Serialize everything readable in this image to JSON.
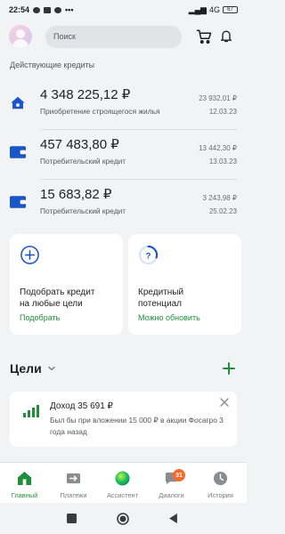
{
  "status_bar": {
    "time": "22:54",
    "signal": "4G",
    "battery": "67"
  },
  "header": {
    "search_placeholder": "Поиск",
    "avatar_icon": "user-avatar",
    "cart_icon": "shopping-cart-icon",
    "bell_icon": "bell-icon"
  },
  "credits": {
    "section_label": "Действующие кредиты",
    "items": [
      {
        "icon": "house-icon",
        "amount": "4 348 225,12 ₽",
        "description": "Приобретение строящегося жилья",
        "payment": "23 932,01 ₽",
        "date": "12.03.23"
      },
      {
        "icon": "wallet-icon",
        "amount": "457 483,80 ₽",
        "description": "Потребительский кредит",
        "payment": "13 442,30 ₽",
        "date": "13.03.23"
      },
      {
        "icon": "wallet-icon",
        "amount": "15 683,82 ₽",
        "description": "Потребительский кредит",
        "payment": "3 243,98 ₽",
        "date": "25.02.23"
      }
    ]
  },
  "cards": {
    "pick": {
      "title_line1": "Подобрать кредит",
      "title_line2": "на любые цели",
      "action": "Подобрать"
    },
    "potential": {
      "title_line1": "Кредитный",
      "title_line2": "потенциал",
      "action": "Можно обновить"
    }
  },
  "goals": {
    "title": "Цели",
    "promo": {
      "title": "Доход 35 691 ₽",
      "text": "Был бы при вложении 15 000 ₽ в акции Фосагро 3 года назад"
    }
  },
  "bottom_nav": {
    "items": [
      {
        "label": "Главный",
        "icon": "home-icon",
        "active": true
      },
      {
        "label": "Платежи",
        "icon": "payments-icon",
        "active": false
      },
      {
        "label": "Ассистент",
        "icon": "assistant-icon",
        "active": false
      },
      {
        "label": "Диалоги",
        "icon": "dialogs-icon",
        "active": false,
        "badge": "31"
      },
      {
        "label": "История",
        "icon": "history-icon",
        "active": false
      }
    ]
  },
  "colors": {
    "accent_green": "#1f8f3a",
    "brand_blue": "#1a56c9",
    "badge_orange": "#f46b2b",
    "background": "#f2f3f5"
  }
}
